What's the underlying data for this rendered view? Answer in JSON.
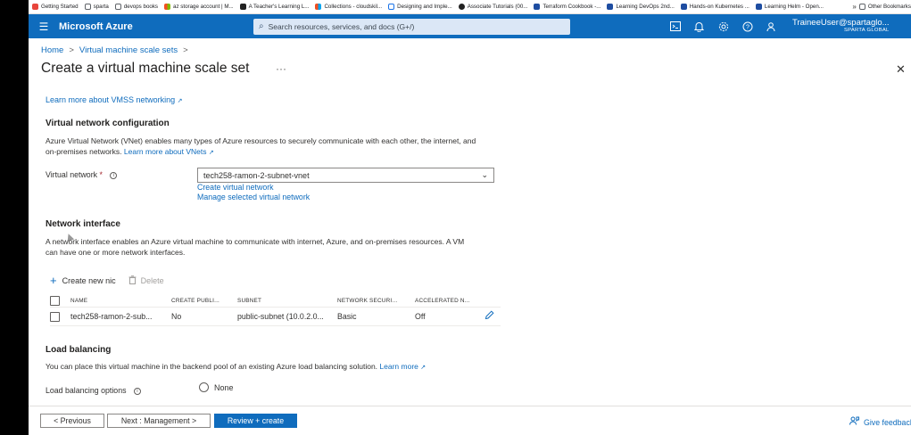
{
  "bookmarks": {
    "items": [
      {
        "label": "Getting Started",
        "color": "#e8453c"
      },
      {
        "label": "sparta",
        "color": "#5f6368"
      },
      {
        "label": "devops books",
        "color": "#5f6368"
      },
      {
        "label": "az storage account | M...",
        "color": "#f25022"
      },
      {
        "label": "A Teacher's Learning L...",
        "color": "#222222"
      },
      {
        "label": "Collections - cloudskil...",
        "color": "#f25022"
      },
      {
        "label": "Designing and Imple...",
        "color": "#1a73e8"
      },
      {
        "label": "Associate Tutorials (00...",
        "color": "#222222"
      },
      {
        "label": "Terraform Cookbook -...",
        "color": "#1e4da1"
      },
      {
        "label": "Learning DevOps 2nd...",
        "color": "#1e4da1"
      },
      {
        "label": "Hands-on Kubernetes ...",
        "color": "#1e4da1"
      },
      {
        "label": "Learning Helm - Open...",
        "color": "#1e4da1"
      }
    ],
    "more_icon": "double-chevron-right-icon",
    "other": "Other Bookmarks"
  },
  "topbar": {
    "brand": "Microsoft Azure",
    "search_placeholder": "Search resources, services, and docs (G+/)",
    "user": "TraineeUser@spartaglo...",
    "org": "SPARTA GLOBAL",
    "accent": "#0f6cbd"
  },
  "breadcrumb": {
    "home": "Home",
    "sep": ">",
    "parent": "Virtual machine scale sets"
  },
  "page": {
    "title": "Create a virtual machine scale set",
    "more": "···",
    "close": "✕"
  },
  "content": {
    "learn_vmss": "Learn more about VMSS networking",
    "vnet_heading": "Virtual network configuration",
    "vnet_desc_line1": "Azure Virtual Network (VNet) enables many types of Azure resources to securely communicate with each other, the internet, and",
    "vnet_desc_line2": "on-premises networks.",
    "vnet_learn": "Learn more about VNets",
    "vnet_label": "Virtual network",
    "vnet_required": "*",
    "vnet_value": "tech258-ramon-2-subnet-vnet",
    "create_vnet": "Create virtual network",
    "manage_vnet": "Manage selected virtual network",
    "nic_heading": "Network interface",
    "nic_desc_line1": "A network interface enables an Azure virtual machine to communicate with internet, Azure, and on-premises resources. A VM",
    "nic_desc_line2": "can have one or more network interfaces.",
    "create_nic": "Create new nic",
    "delete": "Delete",
    "table": {
      "headers": [
        "NAME",
        "CREATE PUBLI...",
        "SUBNET",
        "NETWORK SECURI...",
        "ACCELERATED N..."
      ],
      "row": [
        "tech258-ramon-2-sub...",
        "No",
        "public-subnet (10.0.2.0...",
        "Basic",
        "Off"
      ]
    },
    "lb_heading": "Load balancing",
    "lb_desc": "You can place this virtual machine in the backend pool of an existing Azure load balancing solution.",
    "lb_learn": "Learn more",
    "lb_label": "Load balancing options",
    "lb_option_none": "None"
  },
  "footer": {
    "previous": "< Previous",
    "next": "Next : Management >",
    "review": "Review + create",
    "feedback": "Give feedback"
  }
}
